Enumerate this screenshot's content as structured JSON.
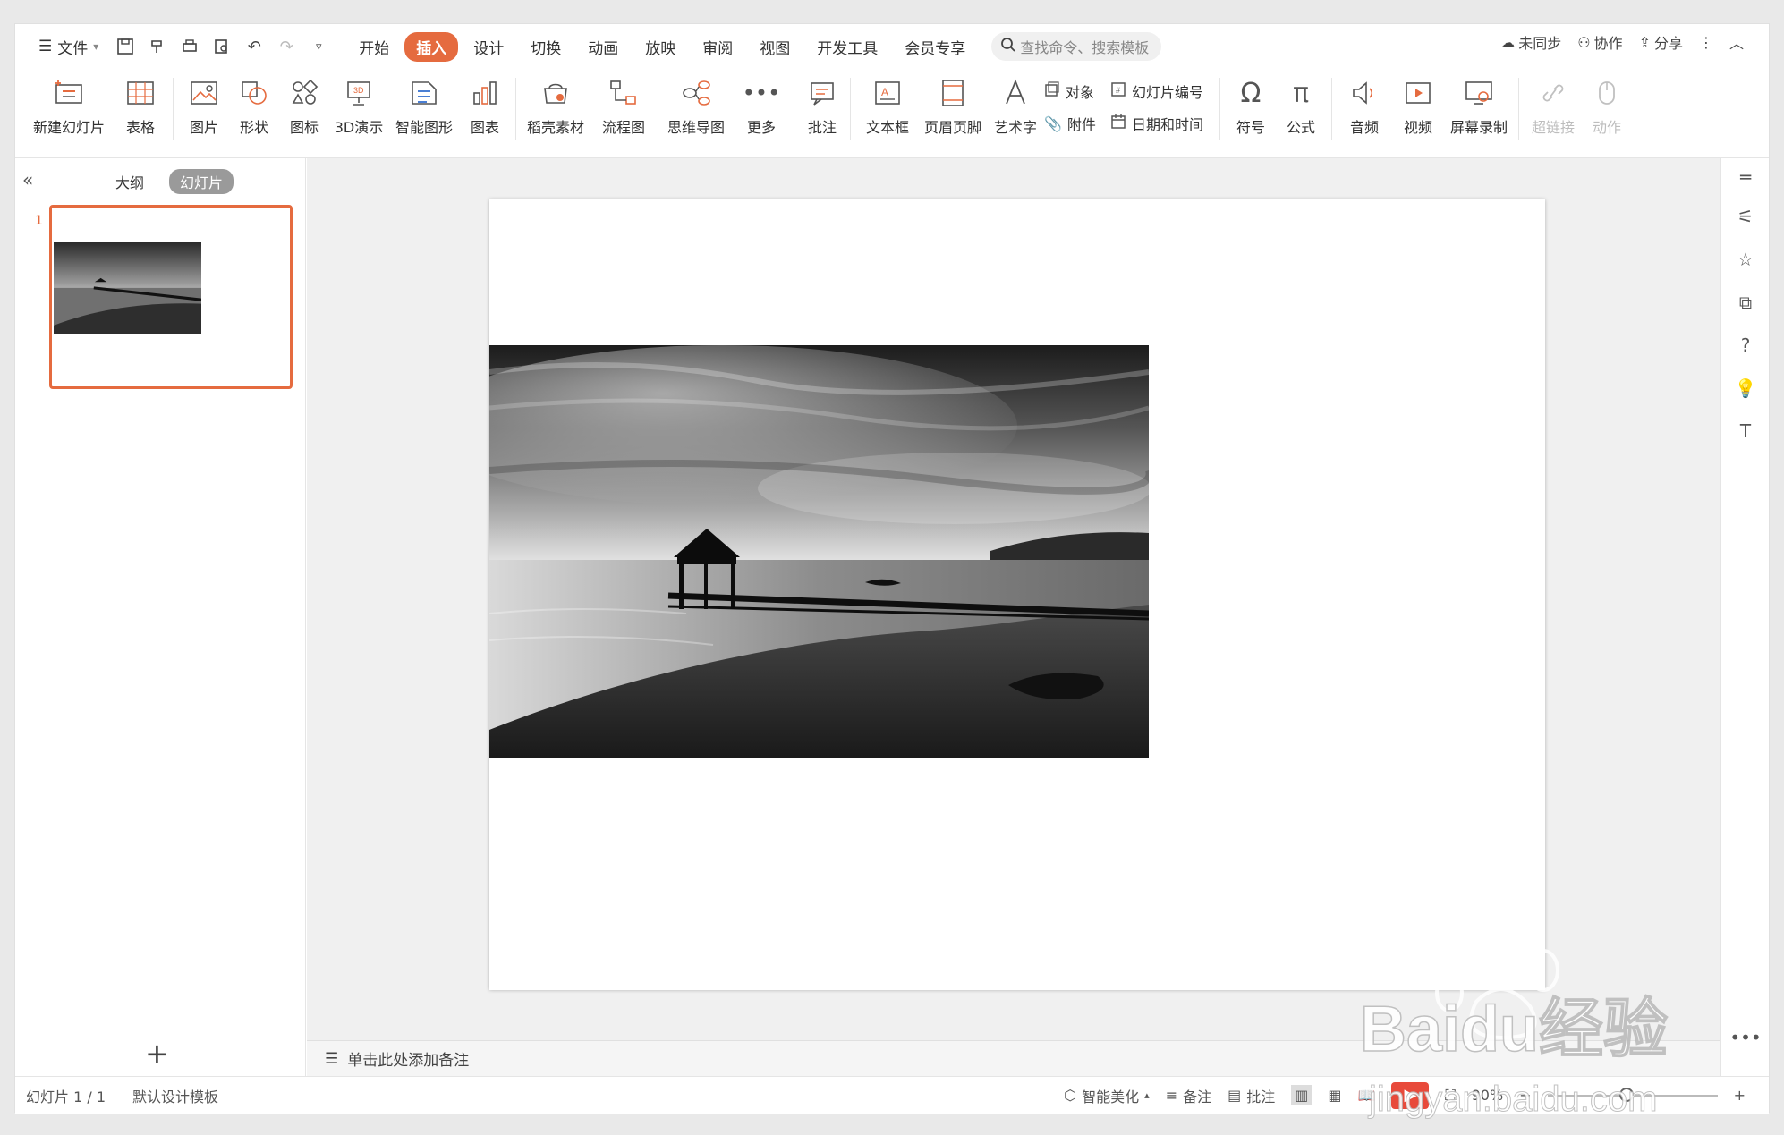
{
  "menu": {
    "file_label": "文件",
    "tabs": [
      "开始",
      "插入",
      "设计",
      "切换",
      "动画",
      "放映",
      "审阅",
      "视图",
      "开发工具",
      "会员专享"
    ],
    "active_tab": "插入",
    "search_placeholder": "查找命令、搜索模板",
    "right": {
      "sync": "未同步",
      "collab": "协作",
      "share": "分享"
    }
  },
  "ribbon": {
    "new_slide": "新建幻灯片",
    "table": "表格",
    "picture": "图片",
    "shape": "形状",
    "icon": "图标",
    "demo3d": "3D演示",
    "smartart": "智能图形",
    "chart": "图表",
    "material": "稻壳素材",
    "flowchart": "流程图",
    "mindmap": "思维导图",
    "more": "更多",
    "comment": "批注",
    "textbox": "文本框",
    "header_footer": "页眉页脚",
    "wordart": "艺术字",
    "object": "对象",
    "slide_number": "幻灯片编号",
    "attachment": "附件",
    "datetime": "日期和时间",
    "symbol": "符号",
    "formula": "公式",
    "audio": "音频",
    "video": "视频",
    "screen_record": "屏幕录制",
    "hyperlink": "超链接",
    "action": "动作"
  },
  "left_panel": {
    "tab_outline": "大纲",
    "tab_slides": "幻灯片",
    "slide_number": "1"
  },
  "notes": {
    "placeholder": "单击此处添加备注"
  },
  "status": {
    "slide_info": "幻灯片 1 / 1",
    "template": "默认设计模板",
    "beautify": "智能美化",
    "notes": "备注",
    "comment": "批注",
    "zoom": "90%"
  },
  "watermark": {
    "brand": "Baidu经验",
    "url": "jingyan.baidu.com"
  },
  "colors": {
    "accent": "#e56b3f"
  }
}
